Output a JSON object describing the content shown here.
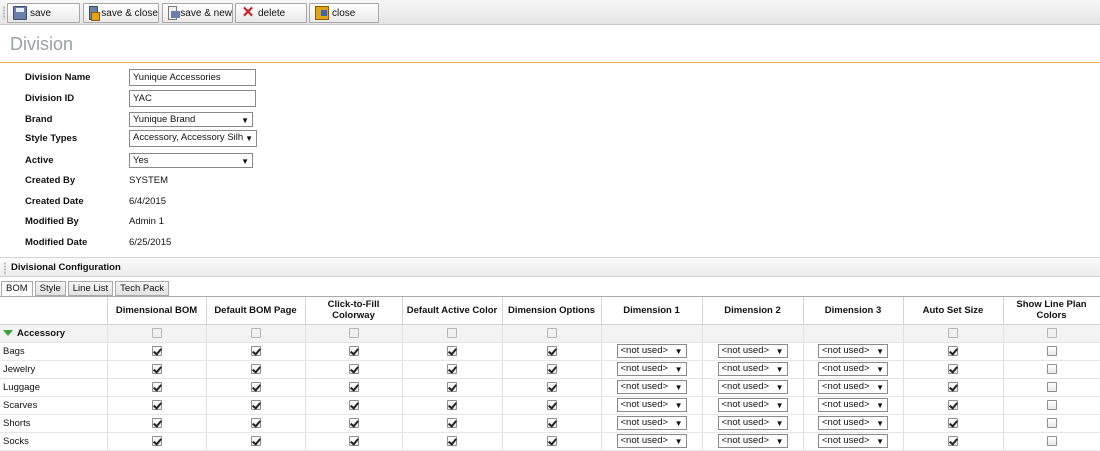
{
  "toolbar": {
    "buttons": [
      {
        "id": "save",
        "label": "save",
        "icon": "save-icon"
      },
      {
        "id": "save_close",
        "label": "save & close",
        "icon": "save-close-icon"
      },
      {
        "id": "save_new",
        "label": "save & new",
        "icon": "save-new-icon"
      },
      {
        "id": "delete",
        "label": "delete",
        "icon": "delete-icon"
      },
      {
        "id": "close",
        "label": "close",
        "icon": "close-icon"
      }
    ]
  },
  "page": {
    "title": "Division"
  },
  "form": {
    "division_name": {
      "label": "Division Name",
      "value": "Yunique Accessories"
    },
    "division_id": {
      "label": "Division ID",
      "value": "YAC"
    },
    "brand": {
      "label": "Brand",
      "value": "Yunique Brand"
    },
    "style_types": {
      "label": "Style Types",
      "value": "Accessory, Accessory Silho"
    },
    "active": {
      "label": "Active",
      "value": "Yes"
    },
    "created_by": {
      "label": "Created By",
      "value": "SYSTEM"
    },
    "created_date": {
      "label": "Created Date",
      "value": "6/4/2015"
    },
    "modified_by": {
      "label": "Modified By",
      "value": "Admin 1"
    },
    "modified_date": {
      "label": "Modified Date",
      "value": "6/25/2015"
    }
  },
  "section": {
    "title": "Divisional Configuration"
  },
  "tabs": [
    {
      "label": "BOM",
      "active": true
    },
    {
      "label": "Style",
      "active": false
    },
    {
      "label": "Line List",
      "active": false
    },
    {
      "label": "Tech Pack",
      "active": false
    }
  ],
  "grid": {
    "columns": [
      "",
      "Dimensional BOM",
      "Default BOM Page",
      "Click-to-Fill Colorway",
      "Default Active Color",
      "Dimension Options",
      "Dimension 1",
      "Dimension 2",
      "Dimension 3",
      "Auto Set Size",
      "Show Line Plan Colors"
    ],
    "group": {
      "name": "Accessory"
    },
    "select_value": "<not used>",
    "rows": [
      {
        "name": "Bags",
        "checks": [
          true,
          true,
          true,
          true,
          true,
          true,
          false
        ]
      },
      {
        "name": "Jewelry",
        "checks": [
          true,
          true,
          true,
          true,
          true,
          true,
          false
        ]
      },
      {
        "name": "Luggage",
        "checks": [
          true,
          true,
          true,
          true,
          true,
          true,
          false
        ]
      },
      {
        "name": "Scarves",
        "checks": [
          true,
          true,
          true,
          true,
          true,
          true,
          false
        ]
      },
      {
        "name": "Shorts",
        "checks": [
          true,
          true,
          true,
          true,
          true,
          true,
          false
        ]
      },
      {
        "name": "Socks",
        "checks": [
          true,
          true,
          true,
          true,
          true,
          true,
          false
        ]
      }
    ]
  }
}
